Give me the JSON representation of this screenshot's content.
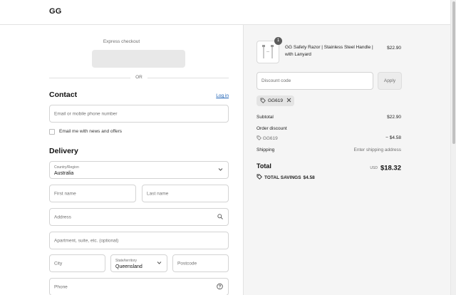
{
  "header": {
    "logo": "GG"
  },
  "express": {
    "label": "Express checkout",
    "or": "OR"
  },
  "contact": {
    "title": "Contact",
    "login": "Log in",
    "email_placeholder": "Email or mobile phone number",
    "newsletter": "Email me with news and offers"
  },
  "delivery": {
    "title": "Delivery",
    "country_label": "Country/Region",
    "country_value": "Australia",
    "first_name": "First name",
    "last_name": "Last name",
    "address": "Address",
    "apartment": "Apartment, suite, etc. (optional)",
    "city": "City",
    "state_label": "State/territory",
    "state_value": "Queensland",
    "postcode": "Postcode",
    "phone": "Phone"
  },
  "summary": {
    "product": {
      "name": "GG Safety Razor | Stainless Steel Handle | with Lanyard",
      "price": "$22.90",
      "qty": "1"
    },
    "discount_placeholder": "Discount code",
    "apply": "Apply",
    "applied_code": "GG619",
    "subtotal_label": "Subtotal",
    "subtotal_value": "$22.90",
    "order_discount_label": "Order discount",
    "discount_code": "GG619",
    "discount_value": "− $4.58",
    "shipping_label": "Shipping",
    "shipping_value": "Enter shipping address",
    "total_label": "Total",
    "currency": "USD",
    "total_value": "$18.32",
    "savings_label": "TOTAL SAVINGS",
    "savings_value": "$4.58"
  },
  "icons": {
    "search": "search-icon",
    "chevron": "chevron-down-icon",
    "help": "help-icon",
    "tag": "tag-icon",
    "close": "close-icon"
  }
}
